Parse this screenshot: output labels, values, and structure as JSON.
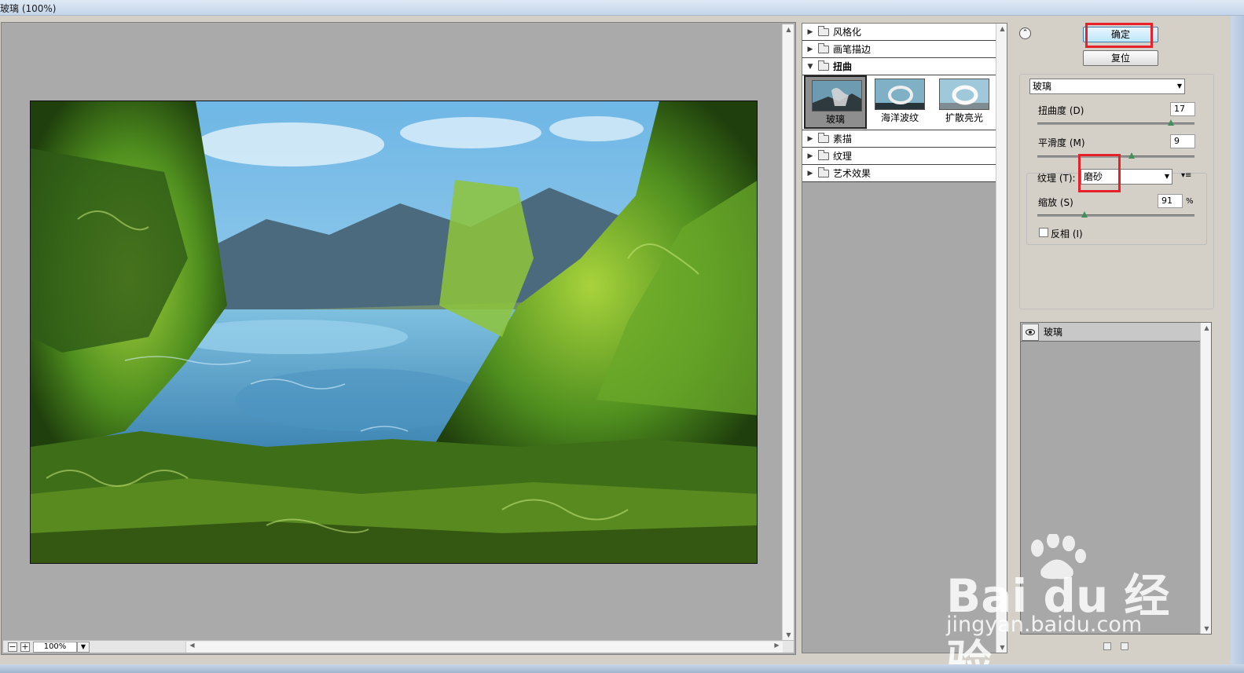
{
  "window": {
    "title": "玻璃 (100%)"
  },
  "preview": {
    "zoom_value": "100%"
  },
  "gallery": {
    "categories": [
      {
        "label": "风格化",
        "expanded": false
      },
      {
        "label": "画笔描边",
        "expanded": false
      },
      {
        "label": "扭曲",
        "expanded": true
      },
      {
        "label": "素描",
        "expanded": false
      },
      {
        "label": "纹理",
        "expanded": false
      },
      {
        "label": "艺术效果",
        "expanded": false
      }
    ],
    "distort_filters": [
      {
        "label": "玻璃",
        "selected": true
      },
      {
        "label": "海洋波纹",
        "selected": false
      },
      {
        "label": "扩散亮光",
        "selected": false
      }
    ]
  },
  "actions": {
    "ok_label": "确定",
    "reset_label": "复位"
  },
  "settings": {
    "filter_select": "玻璃",
    "distortion": {
      "label": "扭曲度 (D)",
      "value": "17",
      "level_fraction": 0.85
    },
    "smoothness": {
      "label": "平滑度 (M)",
      "value": "9",
      "level_fraction": 0.6
    },
    "texture": {
      "label": "纹理 (T):",
      "value": "磨砂"
    },
    "scaling": {
      "label": "缩放 (S)",
      "value": "91",
      "unit": "%",
      "level_fraction": 0.3
    },
    "invert": {
      "label": "反相 (I)",
      "checked": false
    }
  },
  "layers": [
    {
      "label": "玻璃",
      "visible": true
    }
  ],
  "watermark": {
    "brand": "Bai du 经验",
    "url": "jingyan.baidu.com"
  },
  "colors": {
    "highlight": "#e8202a",
    "ok_button": "#bde6fd",
    "panel_bg": "#d4d0c8"
  }
}
